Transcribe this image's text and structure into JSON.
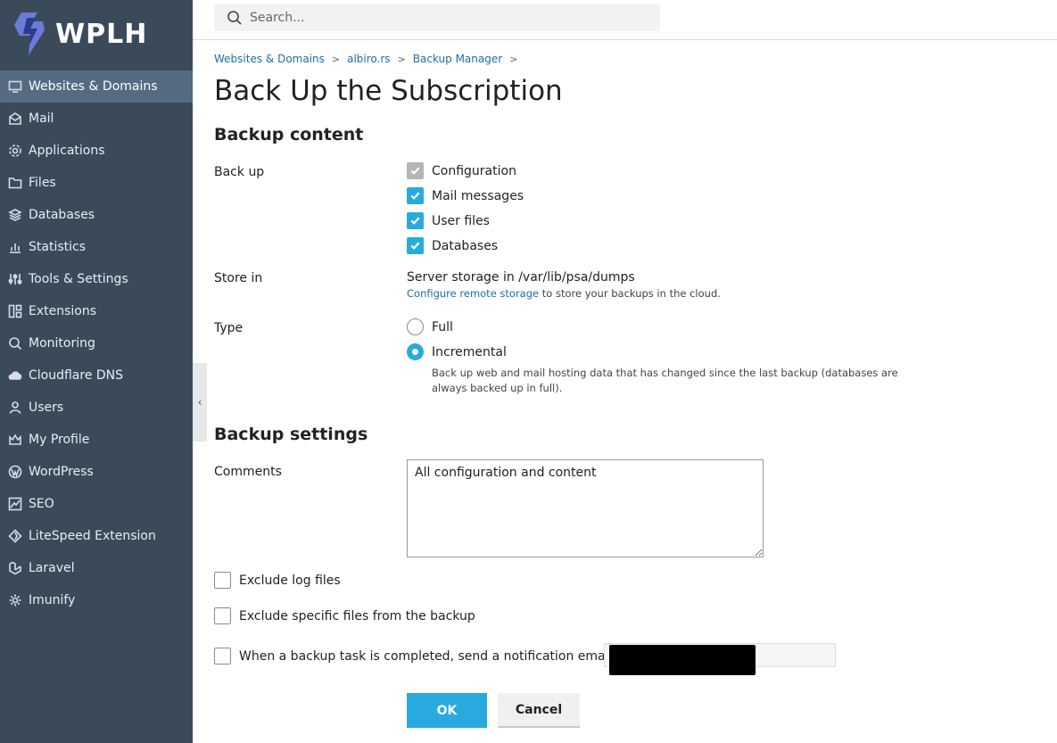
{
  "brand": {
    "name": "WPLH",
    "logo_icon": "lightning-shield-icon"
  },
  "search": {
    "placeholder": "Search..."
  },
  "sidebar": {
    "items": [
      {
        "label": "Websites & Domains",
        "icon": "monitor-icon",
        "active": true
      },
      {
        "label": "Mail",
        "icon": "mail-icon"
      },
      {
        "label": "Applications",
        "icon": "gear-icon"
      },
      {
        "label": "Files",
        "icon": "folder-icon"
      },
      {
        "label": "Databases",
        "icon": "layers-icon"
      },
      {
        "label": "Statistics",
        "icon": "bar-chart-icon"
      },
      {
        "label": "Tools & Settings",
        "icon": "sliders-icon"
      },
      {
        "label": "Extensions",
        "icon": "puzzle-icon"
      },
      {
        "label": "Monitoring",
        "icon": "magnifier-icon"
      },
      {
        "label": "Cloudflare DNS",
        "icon": "cloud-icon"
      },
      {
        "label": "Users",
        "icon": "user-icon"
      },
      {
        "label": "My Profile",
        "icon": "crown-icon"
      },
      {
        "label": "WordPress",
        "icon": "wordpress-icon"
      },
      {
        "label": "SEO",
        "icon": "trend-icon"
      },
      {
        "label": "LiteSpeed Extension",
        "icon": "litespeed-icon"
      },
      {
        "label": "Laravel",
        "icon": "laravel-icon"
      },
      {
        "label": "Imunify",
        "icon": "cog-icon"
      }
    ]
  },
  "breadcrumb": [
    "Websites & Domains",
    "albiro.rs",
    "Backup Manager"
  ],
  "page_title": "Back Up the Subscription",
  "backup_content": {
    "heading": "Backup content",
    "backup_label": "Back up",
    "options": [
      {
        "label": "Configuration",
        "state": "disabled-checked"
      },
      {
        "label": "Mail messages",
        "state": "checked"
      },
      {
        "label": "User files",
        "state": "checked"
      },
      {
        "label": "Databases",
        "state": "checked"
      }
    ],
    "store_label": "Store in",
    "store_value": "Server storage in /var/lib/psa/dumps",
    "remote_link": "Configure remote storage",
    "remote_suffix": " to store your backups in the cloud.",
    "type_label": "Type",
    "type_full": "Full",
    "type_incremental": "Incremental",
    "type_selected": "Incremental",
    "incremental_hint_line1": "Back up web and mail hosting data that has changed since the last backup (databases are",
    "incremental_hint_line2": "always backed up in full)."
  },
  "backup_settings": {
    "heading": "Backup settings",
    "comments_label": "Comments",
    "comments_value": "All configuration and content",
    "exclude_logs": "Exclude log files",
    "exclude_specific": "Exclude specific files from the backup",
    "notify": "When a backup task is completed, send a notification email to"
  },
  "buttons": {
    "ok": "OK",
    "cancel": "Cancel"
  },
  "colors": {
    "accent": "#28aade",
    "sidebar": "#3b4a5a",
    "sidebar_active": "#556b82",
    "link": "#1c6fa8"
  }
}
